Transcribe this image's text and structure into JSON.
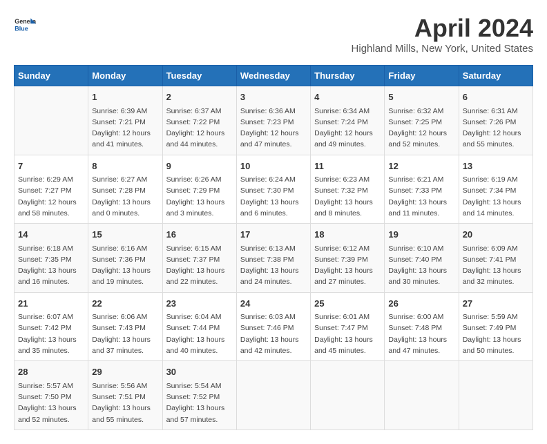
{
  "header": {
    "logo_line1": "General",
    "logo_line2": "Blue",
    "title": "April 2024",
    "subtitle": "Highland Mills, New York, United States"
  },
  "days_of_week": [
    "Sunday",
    "Monday",
    "Tuesday",
    "Wednesday",
    "Thursday",
    "Friday",
    "Saturday"
  ],
  "weeks": [
    [
      {
        "day": "",
        "info": ""
      },
      {
        "day": "1",
        "info": "Sunrise: 6:39 AM\nSunset: 7:21 PM\nDaylight: 12 hours\nand 41 minutes."
      },
      {
        "day": "2",
        "info": "Sunrise: 6:37 AM\nSunset: 7:22 PM\nDaylight: 12 hours\nand 44 minutes."
      },
      {
        "day": "3",
        "info": "Sunrise: 6:36 AM\nSunset: 7:23 PM\nDaylight: 12 hours\nand 47 minutes."
      },
      {
        "day": "4",
        "info": "Sunrise: 6:34 AM\nSunset: 7:24 PM\nDaylight: 12 hours\nand 49 minutes."
      },
      {
        "day": "5",
        "info": "Sunrise: 6:32 AM\nSunset: 7:25 PM\nDaylight: 12 hours\nand 52 minutes."
      },
      {
        "day": "6",
        "info": "Sunrise: 6:31 AM\nSunset: 7:26 PM\nDaylight: 12 hours\nand 55 minutes."
      }
    ],
    [
      {
        "day": "7",
        "info": "Sunrise: 6:29 AM\nSunset: 7:27 PM\nDaylight: 12 hours\nand 58 minutes."
      },
      {
        "day": "8",
        "info": "Sunrise: 6:27 AM\nSunset: 7:28 PM\nDaylight: 13 hours\nand 0 minutes."
      },
      {
        "day": "9",
        "info": "Sunrise: 6:26 AM\nSunset: 7:29 PM\nDaylight: 13 hours\nand 3 minutes."
      },
      {
        "day": "10",
        "info": "Sunrise: 6:24 AM\nSunset: 7:30 PM\nDaylight: 13 hours\nand 6 minutes."
      },
      {
        "day": "11",
        "info": "Sunrise: 6:23 AM\nSunset: 7:32 PM\nDaylight: 13 hours\nand 8 minutes."
      },
      {
        "day": "12",
        "info": "Sunrise: 6:21 AM\nSunset: 7:33 PM\nDaylight: 13 hours\nand 11 minutes."
      },
      {
        "day": "13",
        "info": "Sunrise: 6:19 AM\nSunset: 7:34 PM\nDaylight: 13 hours\nand 14 minutes."
      }
    ],
    [
      {
        "day": "14",
        "info": "Sunrise: 6:18 AM\nSunset: 7:35 PM\nDaylight: 13 hours\nand 16 minutes."
      },
      {
        "day": "15",
        "info": "Sunrise: 6:16 AM\nSunset: 7:36 PM\nDaylight: 13 hours\nand 19 minutes."
      },
      {
        "day": "16",
        "info": "Sunrise: 6:15 AM\nSunset: 7:37 PM\nDaylight: 13 hours\nand 22 minutes."
      },
      {
        "day": "17",
        "info": "Sunrise: 6:13 AM\nSunset: 7:38 PM\nDaylight: 13 hours\nand 24 minutes."
      },
      {
        "day": "18",
        "info": "Sunrise: 6:12 AM\nSunset: 7:39 PM\nDaylight: 13 hours\nand 27 minutes."
      },
      {
        "day": "19",
        "info": "Sunrise: 6:10 AM\nSunset: 7:40 PM\nDaylight: 13 hours\nand 30 minutes."
      },
      {
        "day": "20",
        "info": "Sunrise: 6:09 AM\nSunset: 7:41 PM\nDaylight: 13 hours\nand 32 minutes."
      }
    ],
    [
      {
        "day": "21",
        "info": "Sunrise: 6:07 AM\nSunset: 7:42 PM\nDaylight: 13 hours\nand 35 minutes."
      },
      {
        "day": "22",
        "info": "Sunrise: 6:06 AM\nSunset: 7:43 PM\nDaylight: 13 hours\nand 37 minutes."
      },
      {
        "day": "23",
        "info": "Sunrise: 6:04 AM\nSunset: 7:44 PM\nDaylight: 13 hours\nand 40 minutes."
      },
      {
        "day": "24",
        "info": "Sunrise: 6:03 AM\nSunset: 7:46 PM\nDaylight: 13 hours\nand 42 minutes."
      },
      {
        "day": "25",
        "info": "Sunrise: 6:01 AM\nSunset: 7:47 PM\nDaylight: 13 hours\nand 45 minutes."
      },
      {
        "day": "26",
        "info": "Sunrise: 6:00 AM\nSunset: 7:48 PM\nDaylight: 13 hours\nand 47 minutes."
      },
      {
        "day": "27",
        "info": "Sunrise: 5:59 AM\nSunset: 7:49 PM\nDaylight: 13 hours\nand 50 minutes."
      }
    ],
    [
      {
        "day": "28",
        "info": "Sunrise: 5:57 AM\nSunset: 7:50 PM\nDaylight: 13 hours\nand 52 minutes."
      },
      {
        "day": "29",
        "info": "Sunrise: 5:56 AM\nSunset: 7:51 PM\nDaylight: 13 hours\nand 55 minutes."
      },
      {
        "day": "30",
        "info": "Sunrise: 5:54 AM\nSunset: 7:52 PM\nDaylight: 13 hours\nand 57 minutes."
      },
      {
        "day": "",
        "info": ""
      },
      {
        "day": "",
        "info": ""
      },
      {
        "day": "",
        "info": ""
      },
      {
        "day": "",
        "info": ""
      }
    ]
  ]
}
